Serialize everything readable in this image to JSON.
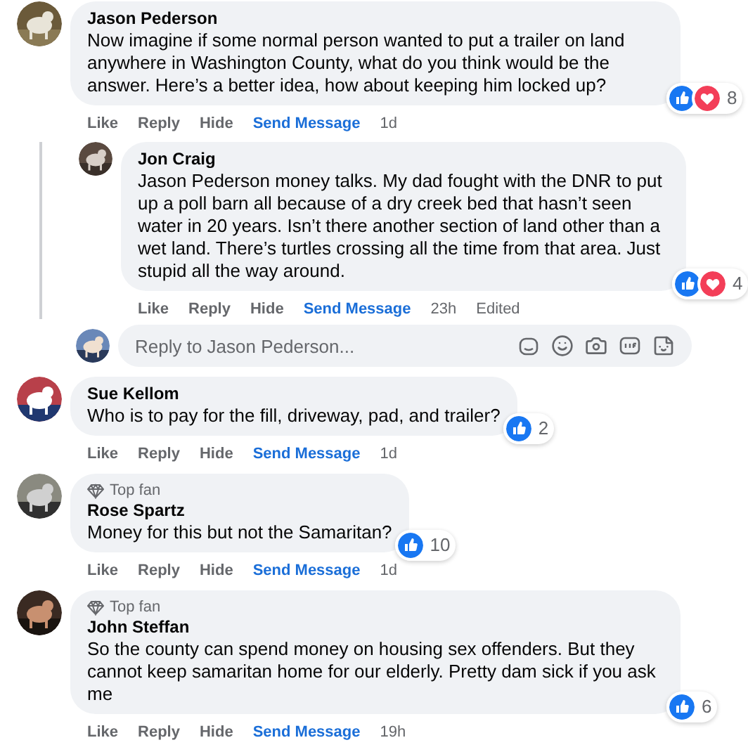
{
  "comments": [
    {
      "name": "Jason Pederson",
      "text": "Now imagine if some normal person wanted to put a trailer on land anywhere in Washington County, what do you think would be the answer. Here’s a better idea, how about keeping him locked up?",
      "avatar": {
        "kind": "picture"
      },
      "reactions": {
        "icons": [
          {
            "kind": "like"
          },
          {
            "kind": "love"
          }
        ],
        "count": "8"
      },
      "actions": [
        "Like",
        "Reply",
        "Hide",
        "Send Message"
      ],
      "time": "1d",
      "replies": [
        {
          "name": "Jon Craig",
          "text": "Jason Pederson money talks. My dad fought with the DNR to put up a poll barn all because of a dry creek bed that hasn’t seen water in 20 years. Isn’t there another section of land other than a wet land. There’s turtles crossing all the time from that area. Just stupid all the way around.",
          "avatar": {
            "kind": "picture"
          },
          "reactions": {
            "icons": [
              {
                "kind": "like"
              },
              {
                "kind": "love"
              }
            ],
            "count": "4"
          },
          "actions": [
            "Like",
            "Reply",
            "Hide",
            "Send Message"
          ],
          "time": "23h",
          "edited": "Edited"
        }
      ],
      "reply_box": {
        "placeholder": "Reply to Jason Pederson...",
        "avatar": {
          "kind": "picture"
        }
      }
    },
    {
      "name": "Sue Kellom",
      "text": "Who is to pay for the fill, driveway, pad, and trailer?",
      "avatar": {
        "kind": "picture"
      },
      "reactions": {
        "icons": [
          {
            "kind": "like"
          }
        ],
        "count": "2"
      },
      "actions": [
        "Like",
        "Reply",
        "Hide",
        "Send Message"
      ],
      "time": "1d"
    },
    {
      "badge": "Top fan",
      "name": "Rose Spartz",
      "text": "Money for this but not the Samaritan?",
      "avatar": {
        "kind": "picture"
      },
      "reactions": {
        "icons": [
          {
            "kind": "like"
          }
        ],
        "count": "10"
      },
      "actions": [
        "Like",
        "Reply",
        "Hide",
        "Send Message"
      ],
      "time": "1d"
    },
    {
      "badge": "Top fan",
      "name": "John Steffan",
      "text": "So the county can spend money on housing sex offenders. But they cannot keep samaritan home for our elderly. Pretty dam sick if you ask me",
      "avatar": {
        "kind": "picture"
      },
      "reactions": {
        "icons": [
          {
            "kind": "like"
          }
        ],
        "count": "6"
      },
      "actions": [
        "Like",
        "Reply",
        "Hide",
        "Send Message"
      ],
      "time": "19h"
    }
  ]
}
